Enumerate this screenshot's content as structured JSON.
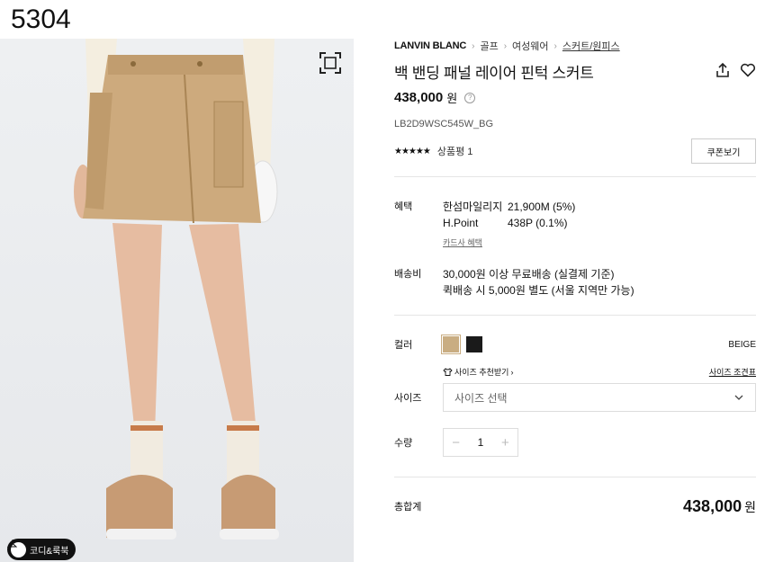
{
  "page_number": "5304",
  "image": {
    "coord_button": "코디&룩북"
  },
  "breadcrumb": {
    "brand": "LANVIN BLANC",
    "items": [
      "골프",
      "여성웨어",
      "스커트/원피스"
    ]
  },
  "product": {
    "title": "백 밴딩 패널 레이어 핀턱 스커트",
    "price": "438,000",
    "price_unit": "원",
    "sku": "LB2D9WSC545W_BG",
    "stars": "★★★★★",
    "review_label": "상품평 1",
    "coupon_button": "쿠폰보기"
  },
  "benefits": {
    "label": "혜택",
    "rows": [
      {
        "name": "한섬마일리지",
        "value": "21,900M (5%)"
      },
      {
        "name": "H.Point",
        "value": "438P (0.1%)"
      }
    ],
    "card_link": "카드사 혜택"
  },
  "shipping": {
    "label": "배송비",
    "line1": "30,000원 이상 무료배송 (실결제 기준)",
    "line2": "퀵배송 시 5,000원 별도 (서울 지역만 가능)"
  },
  "color": {
    "label": "컬러",
    "selected_name": "BEIGE",
    "swatches": [
      {
        "name": "beige",
        "hex": "#c9ad82"
      },
      {
        "name": "black",
        "hex": "#1a1a1a"
      }
    ]
  },
  "size": {
    "recommend_link": "사이즈 추천받기",
    "chart_link": "사이즈 조견표",
    "label": "사이즈",
    "placeholder": "사이즈 선택"
  },
  "quantity": {
    "label": "수량",
    "minus": "−",
    "value": "1",
    "plus": "+"
  },
  "total": {
    "label": "총합계",
    "value": "438,000",
    "unit": "원"
  }
}
